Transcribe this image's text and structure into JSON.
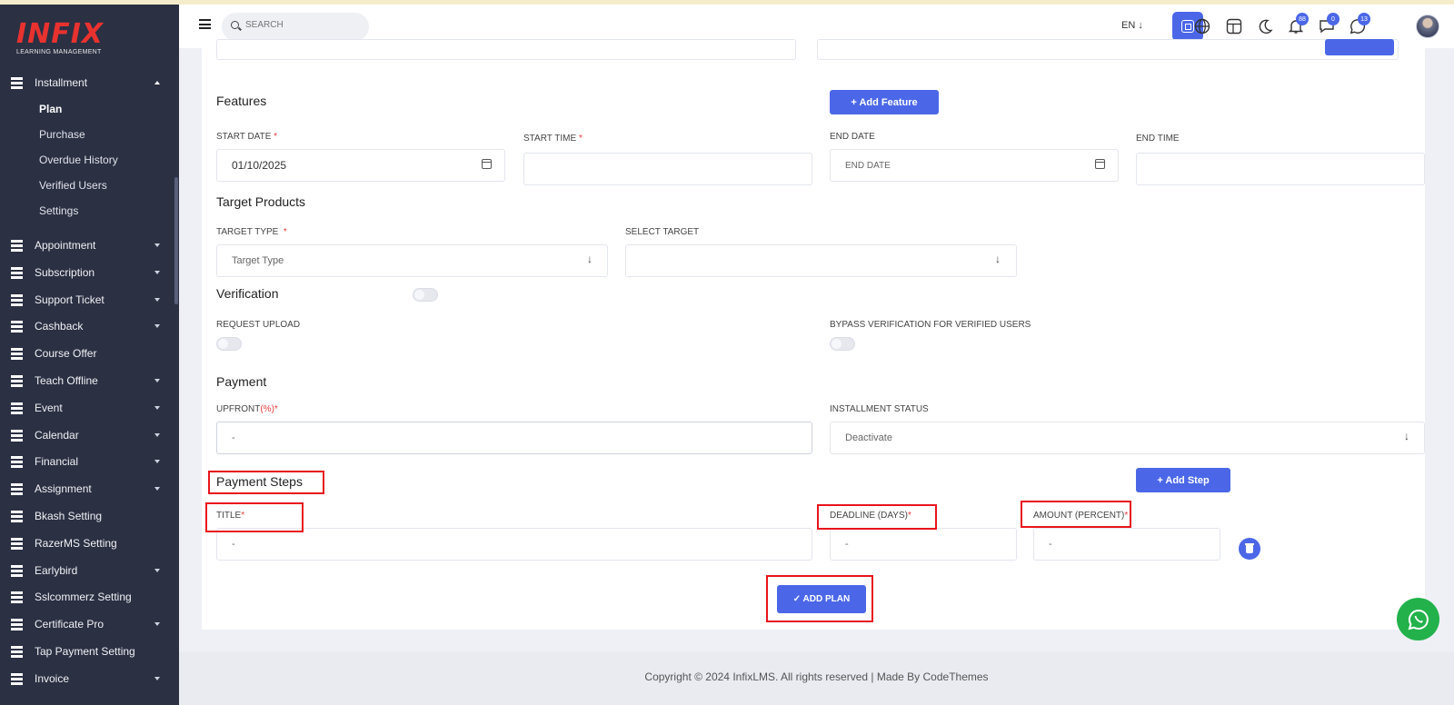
{
  "brand": {
    "name": "INFIX",
    "tagline": "LEARNING MANAGEMENT"
  },
  "header": {
    "search_placeholder": "SEARCH",
    "language": "EN ↓",
    "notification_count": "88",
    "message_count": "0",
    "chat_count": "13"
  },
  "sidebar": {
    "open_section": "Installment",
    "submenu": [
      "Plan",
      "Purchase",
      "Overdue History",
      "Verified Users",
      "Settings"
    ],
    "active_submenu": "Plan",
    "items": [
      {
        "label": "Appointment",
        "caret": true
      },
      {
        "label": "Subscription",
        "caret": true
      },
      {
        "label": "Support Ticket",
        "caret": true
      },
      {
        "label": "Cashback",
        "caret": true
      },
      {
        "label": "Course Offer",
        "caret": false
      },
      {
        "label": "Teach Offline",
        "caret": true
      },
      {
        "label": "Event",
        "caret": true
      },
      {
        "label": "Calendar",
        "caret": true
      },
      {
        "label": "Financial",
        "caret": true
      },
      {
        "label": "Assignment",
        "caret": true
      },
      {
        "label": "Bkash Setting",
        "caret": false
      },
      {
        "label": "RazerMS Setting",
        "caret": false
      },
      {
        "label": "Earlybird",
        "caret": true
      },
      {
        "label": "Sslcommerz Setting",
        "caret": false
      },
      {
        "label": "Certificate Pro",
        "caret": true
      },
      {
        "label": "Tap Payment Setting",
        "caret": false
      },
      {
        "label": "Invoice",
        "caret": true
      }
    ]
  },
  "form": {
    "features_title": "Features",
    "add_feature_label": "+ Add Feature",
    "start_date_label": "START DATE",
    "start_date_value": "01/10/2025",
    "start_time_label": "START TIME",
    "end_date_label": "END DATE",
    "end_date_placeholder": "END DATE",
    "end_time_label": "END TIME",
    "target_products_title": "Target Products",
    "target_type_label": "TARGET TYPE",
    "target_type_placeholder": "Target Type",
    "select_target_label": "SELECT TARGET",
    "verification_title": "Verification",
    "request_upload_label": "REQUEST UPLOAD",
    "bypass_label": "BYPASS VERIFICATION FOR VERIFIED USERS",
    "payment_title": "Payment",
    "upfront_label": "UPFRONT",
    "upfront_unit": "(%)",
    "upfront_placeholder": "-",
    "installment_status_label": "INSTALLMENT STATUS",
    "installment_status_value": "Deactivate",
    "payment_steps_title": "Payment Steps",
    "add_step_label": "+ Add Step",
    "title_label": "TITLE",
    "title_placeholder": "-",
    "deadline_label": "DEADLINE (DAYS)",
    "deadline_placeholder": "-",
    "amount_label": "AMOUNT (PERCENT)",
    "amount_placeholder": "-",
    "submit_label": "✓ ADD PLAN",
    "required_mark": "*"
  },
  "footer": {
    "copyright": "Copyright © 2024 InfixLMS. All rights reserved | Made By CodeThemes"
  },
  "colors": {
    "accent": "#4b67e8",
    "sidebar": "#2b3043",
    "highlight": "#e8141c",
    "whatsapp": "#23b14b"
  }
}
